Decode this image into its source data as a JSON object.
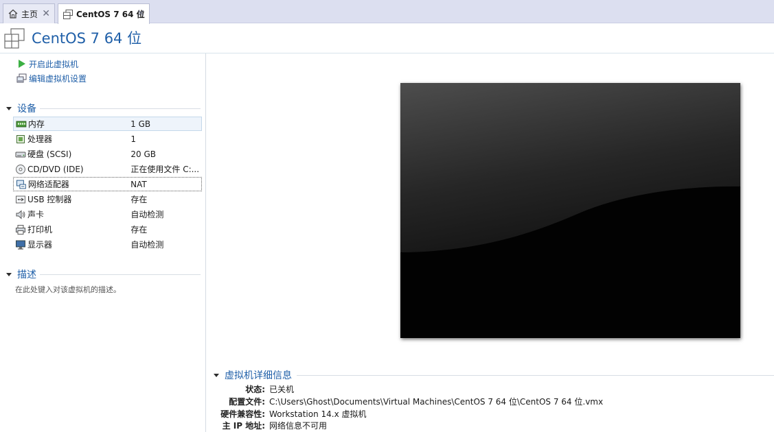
{
  "tabs": [
    {
      "label": "主页",
      "icon": "home-icon",
      "close": "✕"
    },
    {
      "label": "CentOS 7 64 位",
      "icon": "vm-icon",
      "close": "✕",
      "active": true
    }
  ],
  "header": {
    "title": "CentOS 7 64 位"
  },
  "actions": [
    {
      "label": "开启此虚拟机",
      "icon": "power-on-icon"
    },
    {
      "label": "编辑虚拟机设置",
      "icon": "edit-settings-icon"
    }
  ],
  "devices_section": {
    "label": "设备"
  },
  "devices": [
    {
      "name": "内存",
      "value": "1 GB",
      "icon": "memory-icon"
    },
    {
      "name": "处理器",
      "value": "1",
      "icon": "processor-icon"
    },
    {
      "name": "硬盘 (SCSI)",
      "value": "20 GB",
      "icon": "hard-disk-icon"
    },
    {
      "name": "CD/DVD (IDE)",
      "value": "正在使用文件 C:...",
      "icon": "cd-dvd-icon"
    },
    {
      "name": "网络适配器",
      "value": "NAT",
      "icon": "network-adapter-icon"
    },
    {
      "name": "USB 控制器",
      "value": "存在",
      "icon": "usb-icon"
    },
    {
      "name": "声卡",
      "value": "自动检测",
      "icon": "sound-card-icon"
    },
    {
      "name": "打印机",
      "value": "存在",
      "icon": "printer-icon"
    },
    {
      "name": "显示器",
      "value": "自动检测",
      "icon": "display-icon"
    }
  ],
  "description_section": {
    "label": "描述",
    "placeholder": "在此处键入对该虚拟机的描述。"
  },
  "details_section": {
    "label": "虚拟机详细信息"
  },
  "details": [
    {
      "key": "状态:",
      "value": "已关机"
    },
    {
      "key": "配置文件:",
      "value": "C:\\Users\\Ghost\\Documents\\Virtual Machines\\CentOS 7 64 位\\CentOS 7 64 位.vmx"
    },
    {
      "key": "硬件兼容性:",
      "value": "Workstation 14.x 虚拟机"
    },
    {
      "key": "主 IP 地址:",
      "value": "网络信息不可用"
    }
  ],
  "colors": {
    "accent": "#1f5fa8",
    "tabbar": "#dcdff0",
    "power_green": "#3cb043"
  }
}
